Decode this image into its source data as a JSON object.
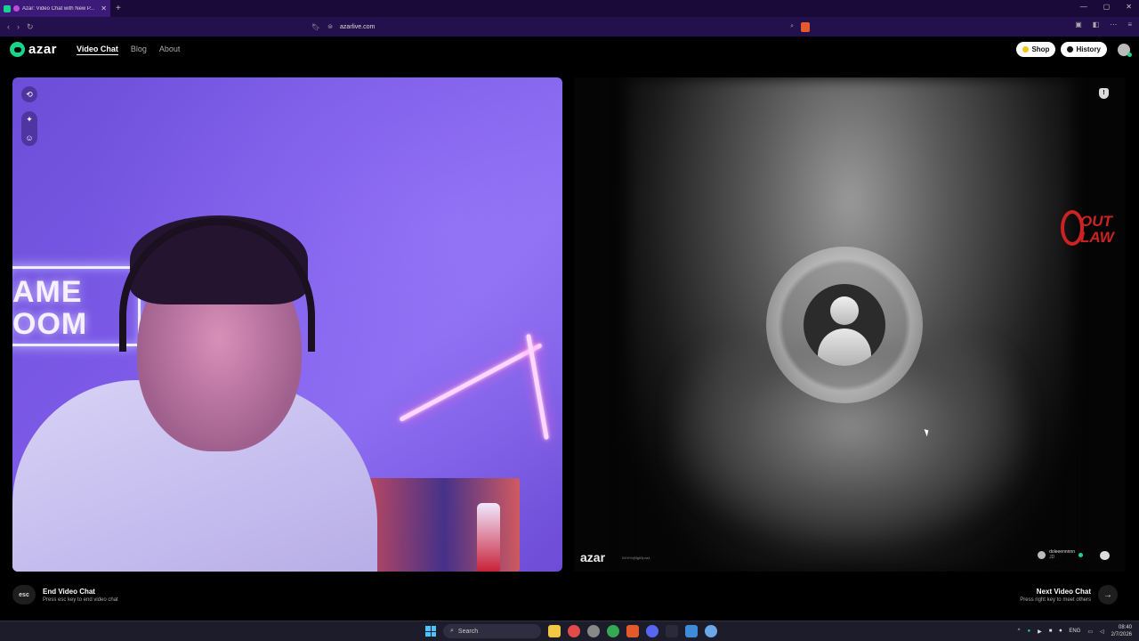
{
  "browser": {
    "tab_title": "Azar: Video Chat with New P...",
    "url": "azarlive.com"
  },
  "site": {
    "brand": "azar",
    "nav": [
      {
        "label": "Video Chat",
        "active": true
      },
      {
        "label": "Blog",
        "active": false
      },
      {
        "label": "About",
        "active": false
      }
    ],
    "shop_label": "Shop",
    "history_label": "History"
  },
  "left_video": {
    "neon_line1": "AME",
    "neon_line2": "OOM"
  },
  "right_video": {
    "watermark": "azar",
    "watermark_id": "04%%@fg63pra4",
    "peer_name": "doleeennnnn",
    "peer_sub": "JD"
  },
  "overlay": {
    "outlaw_1": "OUT",
    "outlaw_2": "LAW"
  },
  "controls": {
    "esc_key": "esc",
    "end_title": "End Video Chat",
    "end_sub": "Press esc key to end video chat",
    "next_title": "Next Video Chat",
    "next_sub": "Press right key to meet others",
    "next_arrow": "→"
  },
  "taskbar": {
    "search_label": "Search",
    "lang": "ENG",
    "time": "08:40",
    "date": "2/7/2026"
  },
  "colors": {
    "accent": "#19d48b",
    "browser_bg": "#24104c",
    "outlaw_red": "#cc2222"
  }
}
